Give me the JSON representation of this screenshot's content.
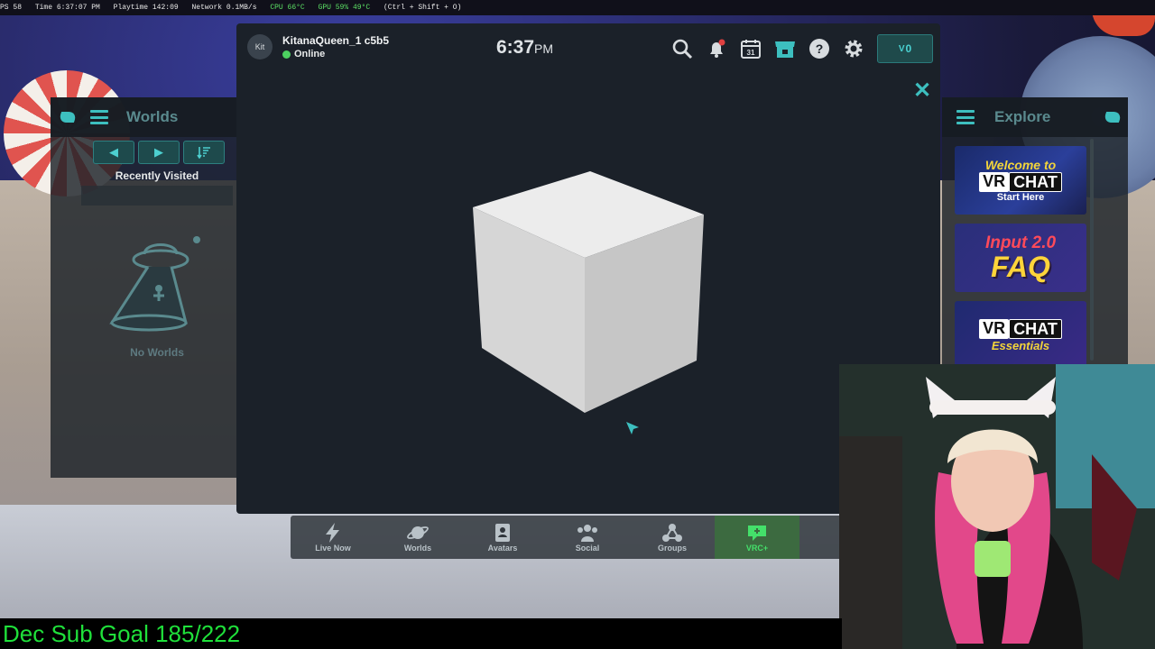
{
  "statusbar": {
    "fps": "PS 58",
    "time": "Time 6:37:07 PM",
    "playtime": "Playtime 142:09",
    "network": "Network 0.1MB/s",
    "cpu": "CPU 66°C",
    "gpu": "GPU 59% 49°C",
    "hotkey": "(Ctrl + Shift + O)"
  },
  "left_panel": {
    "title": "Worlds",
    "section": "Recently Visited",
    "empty_label": "No Worlds"
  },
  "right_panel": {
    "title": "Explore",
    "tiles": [
      {
        "line1": "Welcome to",
        "line2": "VR",
        "line2b": "CHAT",
        "line3": "Start Here"
      },
      {
        "line1": "Input 2.0",
        "line2": "FAQ"
      },
      {
        "line1": "VR",
        "line1b": "CHAT",
        "line2": "Essentials"
      }
    ]
  },
  "header": {
    "avatar_initials": "Kit",
    "username": "KitanaQueen_1 c5b5",
    "status": "Online",
    "time": "6:37",
    "ampm": "PM",
    "vrc_balance": "0",
    "vrc_symbol": "V"
  },
  "dock": [
    {
      "label": "Live Now",
      "icon": "lightning-icon"
    },
    {
      "label": "Worlds",
      "icon": "planet-icon"
    },
    {
      "label": "Avatars",
      "icon": "avatar-book-icon"
    },
    {
      "label": "Social",
      "icon": "people-icon"
    },
    {
      "label": "Groups",
      "icon": "groups-icon"
    },
    {
      "label": "VRC+",
      "icon": "vrcplus-icon"
    }
  ],
  "overlay": {
    "goal": "Dec Sub Goal 185/222"
  },
  "colors": {
    "accent": "#3dbfbf",
    "online": "#4cd060",
    "goal_text": "#1fe03a",
    "panel_bg": "#1b2129"
  }
}
